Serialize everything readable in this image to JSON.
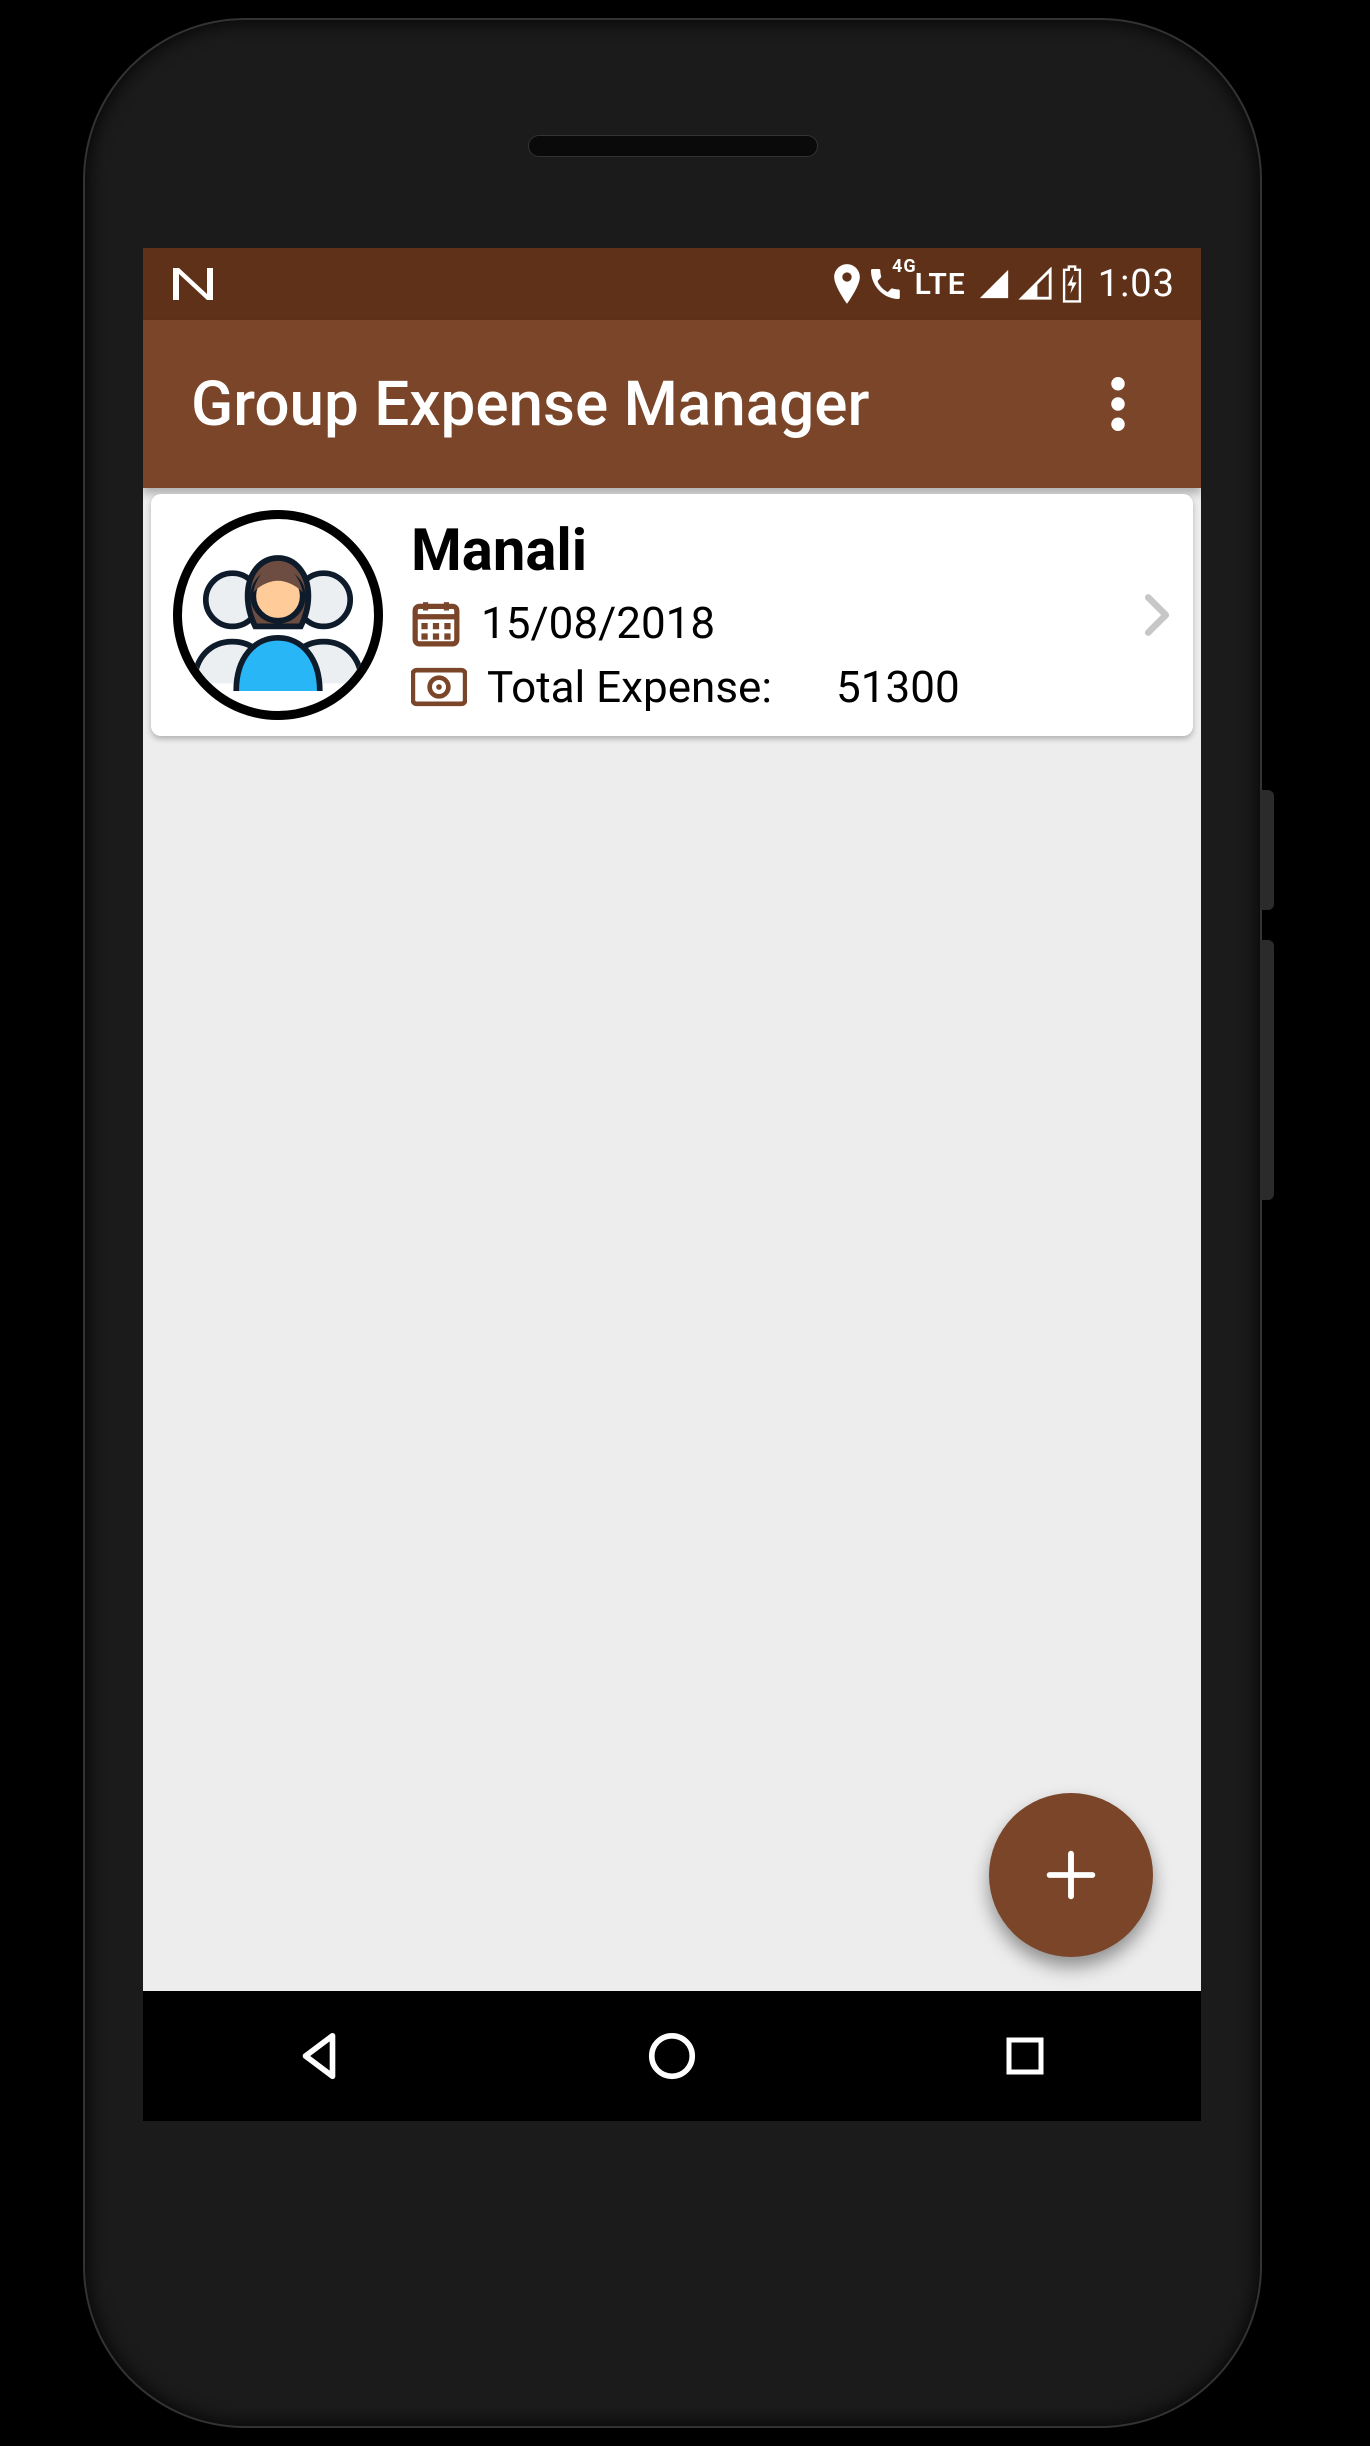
{
  "status_bar": {
    "network_label": "LTE",
    "volte_badge": "4G",
    "time": "1:03"
  },
  "app_bar": {
    "title": "Group Expense Manager"
  },
  "trips": [
    {
      "name": "Manali",
      "date": "15/08/2018",
      "expense_label": "Total Expense:",
      "expense_value": "51300"
    }
  ]
}
